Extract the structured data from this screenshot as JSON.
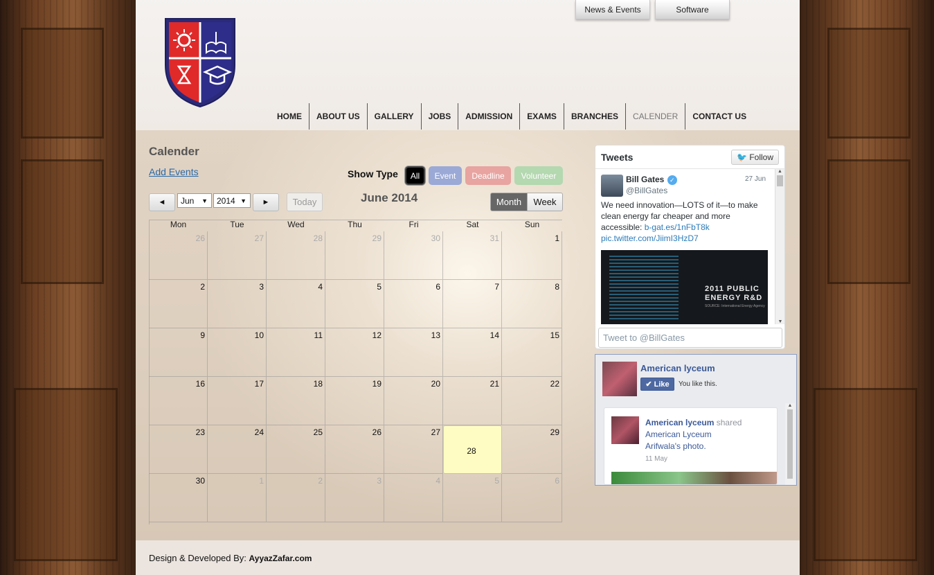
{
  "top_buttons": [
    {
      "label": "News & Events"
    },
    {
      "label": "Software"
    }
  ],
  "nav": [
    {
      "label": "HOME"
    },
    {
      "label": "ABOUT US"
    },
    {
      "label": "GALLERY"
    },
    {
      "label": "JOBS"
    },
    {
      "label": "ADMISSION"
    },
    {
      "label": "EXAMS"
    },
    {
      "label": "BRANCHES"
    },
    {
      "label": "CALENDER"
    },
    {
      "label": "CONTACT US"
    }
  ],
  "calendar": {
    "title": "Calender",
    "add_events": "Add Events",
    "show_type_label": "Show Type",
    "type_buttons": [
      {
        "label": "All",
        "color": "#000000"
      },
      {
        "label": "Event",
        "color": "#9aa9d6"
      },
      {
        "label": "Deadline",
        "color": "#e8a4a0"
      },
      {
        "label": "Volunteer",
        "color": "#b4d8b0"
      }
    ],
    "prev": "◄",
    "next": "►",
    "month_select": "Jun",
    "year_select": "2014",
    "today": "Today",
    "month_title": "June 2014",
    "views": [
      {
        "label": "Month"
      },
      {
        "label": "Week"
      }
    ],
    "weekdays": [
      "Mon",
      "Tue",
      "Wed",
      "Thu",
      "Fri",
      "Sat",
      "Sun"
    ],
    "weeks": [
      [
        "26",
        "27",
        "28",
        "29",
        "30",
        "31",
        "1"
      ],
      [
        "2",
        "3",
        "4",
        "5",
        "6",
        "7",
        "8"
      ],
      [
        "9",
        "10",
        "11",
        "12",
        "13",
        "14",
        "15"
      ],
      [
        "16",
        "17",
        "18",
        "19",
        "20",
        "21",
        "22"
      ],
      [
        "23",
        "24",
        "25",
        "26",
        "27",
        "28",
        "29"
      ],
      [
        "30",
        "1",
        "2",
        "3",
        "4",
        "5",
        "6"
      ]
    ]
  },
  "tweets": {
    "title": "Tweets",
    "follow": "Follow",
    "author": "Bill Gates",
    "handle": "@BillGates",
    "date": "27 Jun",
    "text": "We need innovation—LOTS of it—to make clean energy far cheaper and more accessible:",
    "link1": "b-gat.es/1nFbT8k",
    "link2": "pic.twitter.com/JiimI3HzD7",
    "image_title_1": "2011 PUBLIC",
    "image_title_2": "ENERGY R&D",
    "image_source": "SOURCE: International Energy Agency",
    "reply_placeholder": "Tweet to @BillGates"
  },
  "facebook": {
    "page_name": "American lyceum",
    "like": "Like",
    "you_like": "You like this.",
    "post_author": "American lyceum",
    "post_verb": "shared",
    "post_target": "American Lyceum",
    "post_target2": "Arifwala",
    "post_suffix": "'s photo.",
    "post_date": "11 May"
  },
  "footer": {
    "prefix": "Design & Developed By:",
    "author": "AyyazZafar.com"
  }
}
